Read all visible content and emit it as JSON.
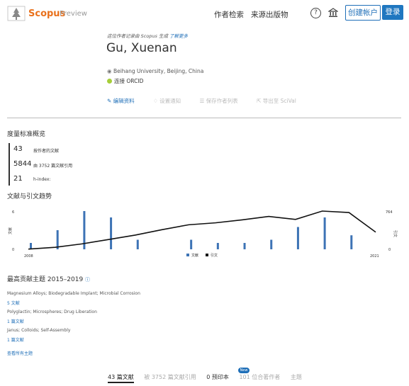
{
  "header": {
    "logo_text": "Scopus",
    "logo_sub": "Preview",
    "nav": [
      "作者检索",
      "来源出版物"
    ],
    "help_icon": "question-circle-icon",
    "institution_icon": "bank-icon",
    "create_account": "创建帐户",
    "login": "登录"
  },
  "profile": {
    "note": "这位作者记录由 Scopus 生成",
    "note_link": "了解更多",
    "name": "Gu, Xuenan",
    "affiliation": "Beihang University, Beijing, China",
    "orcid": "连接 ORCID",
    "actions": [
      "编辑资料",
      "设置通知",
      "保存作者列表",
      "导出至 SciVal"
    ]
  },
  "metrics": {
    "title": "度量标准概览",
    "items": [
      {
        "value": "43",
        "label": "按作者的文献"
      },
      {
        "value": "5844",
        "label": "由 3752 篇文献引用"
      },
      {
        "value": "21",
        "label": "h-index:"
      }
    ]
  },
  "chart_data": {
    "type": "bar",
    "title": "文献与引文趋势",
    "x_start": "2008",
    "x_end": "2021",
    "left_axis_label": "文献",
    "right_axis_label": "引文",
    "left_ticks": [
      "0",
      "6"
    ],
    "right_ticks": [
      "0",
      "764"
    ],
    "legend": [
      "文献",
      "引文"
    ],
    "series": [
      {
        "name": "文献",
        "values": [
          1,
          3,
          6,
          5,
          1.5,
          0,
          1.5,
          1,
          1,
          1.5,
          3.5,
          5,
          2.2
        ]
      },
      {
        "name": "引文",
        "values": [
          5,
          40,
          110,
          200,
          290,
          400,
          500,
          540,
          600,
          670,
          610,
          780,
          750,
          350
        ]
      }
    ],
    "colors": {
      "docs": "#3d73b5",
      "citations": "#111111"
    }
  },
  "topics": {
    "title": "最高贡献主题 2015–2019",
    "items": [
      {
        "name": "Magnesium Alloys; Biodegradable Implant; Microbial Corrosion",
        "count": "5 文献"
      },
      {
        "name": "Polyglactin; Microspheres; Drug Liberation",
        "count": "1 篇文献"
      },
      {
        "name": "Janus; Colloids; Self-Assembly",
        "count": "1 篇文献"
      }
    ],
    "view_all": "查看所有主题"
  },
  "tabs": {
    "items": [
      "43 篇文献",
      "被 3752 篇文献引用",
      "0 预印本",
      "101 位合著作者",
      "主题"
    ],
    "badge": "New"
  }
}
